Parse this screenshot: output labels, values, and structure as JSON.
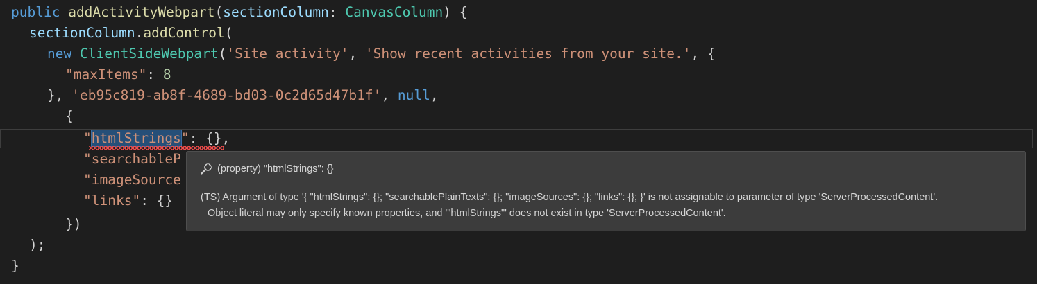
{
  "code": {
    "line1": {
      "kw": "public",
      "fn": "addActivityWebpart",
      "open": "(",
      "param": "sectionColumn",
      "colon": ": ",
      "type": "CanvasColumn",
      "close": ") {"
    },
    "line2": {
      "obj": "sectionColumn",
      "dot": ".",
      "fn": "addControl",
      "open": "("
    },
    "line3": {
      "kw": "new",
      "type": "ClientSideWebpart",
      "open": "(",
      "s1": "'Site activity'",
      "sep": ", ",
      "s2": "'Show recent activities from your site.'",
      "end": ", {"
    },
    "line4": {
      "key": "\"maxItems\"",
      "colon": ": ",
      "num": "8"
    },
    "line5": {
      "start": "}, ",
      "guid": "'eb95c819-ab8f-4689-bd03-0c2d65d47b1f'",
      "sep": ", ",
      "null": "null",
      "end": ","
    },
    "line6": {
      "text": "{"
    },
    "line7": {
      "q1": "\"",
      "key": "htmlStrings",
      "q2": "\"",
      "rest": ": {},"
    },
    "line8": {
      "key": "\"searchableP"
    },
    "line9": {
      "key": "\"imageSource"
    },
    "line10": {
      "key": "\"links\"",
      "rest": ": {}"
    },
    "line11": {
      "text": "})"
    },
    "line12": {
      "text": ");"
    },
    "line13": {
      "text": "}"
    }
  },
  "tooltip": {
    "header": "(property) \"htmlStrings\": {}",
    "icon": "wrench-icon",
    "message_line1": "(TS) Argument of type '{ \"htmlStrings\": {}; \"searchablePlainTexts\": {}; \"imageSources\": {}; \"links\": {}; }' is not assignable to parameter of type 'ServerProcessedContent'.",
    "message_line2": "Object literal may only specify known properties, and '\"htmlStrings\"' does not exist in type 'ServerProcessedContent'."
  },
  "colors": {
    "background": "#1e1e1e",
    "keyword": "#569cd6",
    "function": "#dcdcaa",
    "type": "#4ec9b0",
    "string": "#ce9178",
    "number": "#b5cea8",
    "property": "#9cdcfe",
    "error": "#f14c4c",
    "selection": "#264f78",
    "tooltip_bg": "#3c3c3c"
  }
}
